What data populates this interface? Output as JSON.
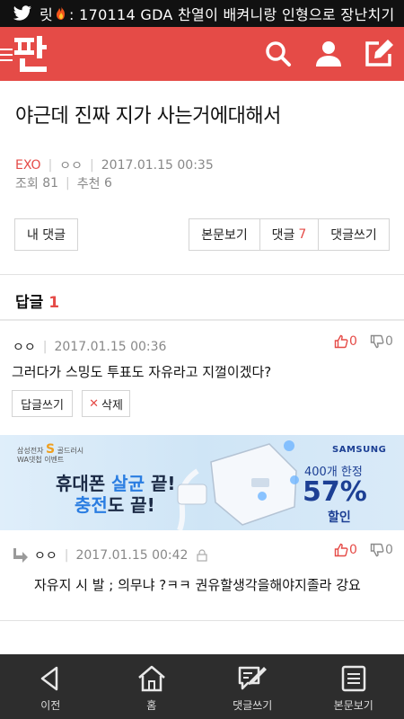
{
  "status_bar": {
    "text_before": "릿",
    "text_after": ": 170114 GDA 찬열이 배켜니랑 인형으로 장난치기"
  },
  "header": {
    "logo_text": "판",
    "accent_color": "#e54b47"
  },
  "post": {
    "title": "야근데 진짜 지가 사는거에대해서",
    "category": "EXO",
    "author": "ㅇㅇ",
    "date": "2017.01.15 00:35",
    "views_label": "조회",
    "views": "81",
    "recommend_label": "추천",
    "recommend": "6"
  },
  "buttons": {
    "my_comments": "내 댓글",
    "view_post": "본문보기",
    "comments": "댓글",
    "comments_count": "7",
    "write_comment": "댓글쓰기"
  },
  "replies": {
    "heading": "답글",
    "count": "1",
    "items": [
      {
        "author": "ㅇㅇ",
        "date": "2017.01.15 00:36",
        "text": "그러다가 스밍도 투표도 자유라고 지껄이겠다?",
        "up": "0",
        "down": "0",
        "reply_button": "답글쓰기",
        "delete_button": "삭제"
      },
      {
        "author": "ㅇㅇ",
        "date": "2017.01.15 00:42",
        "text": "자유지 시 발 ; 의무냐 ?ㅋㅋ 권유할생각을해야지졸라 강요",
        "up": "0",
        "down": "0"
      }
    ]
  },
  "ad": {
    "brand": "삼성전자",
    "brand_mark": "S",
    "brand_name": "골드러시",
    "event": "WA댓첩 이벤트",
    "line1_a": "휴대폰 ",
    "line1_b": "살균",
    "line1_c": " 끝!",
    "line2_a": "충전",
    "line2_b": "도 끝!",
    "samsung": "SAMSUNG",
    "limit": "400개 한정",
    "percent": "57%",
    "discount": "할인"
  },
  "bottom_nav": [
    {
      "label": "이전",
      "icon": "back-icon"
    },
    {
      "label": "홈",
      "icon": "home-icon"
    },
    {
      "label": "댓글쓰기",
      "icon": "comment-write-icon"
    },
    {
      "label": "본문보기",
      "icon": "document-icon"
    }
  ]
}
